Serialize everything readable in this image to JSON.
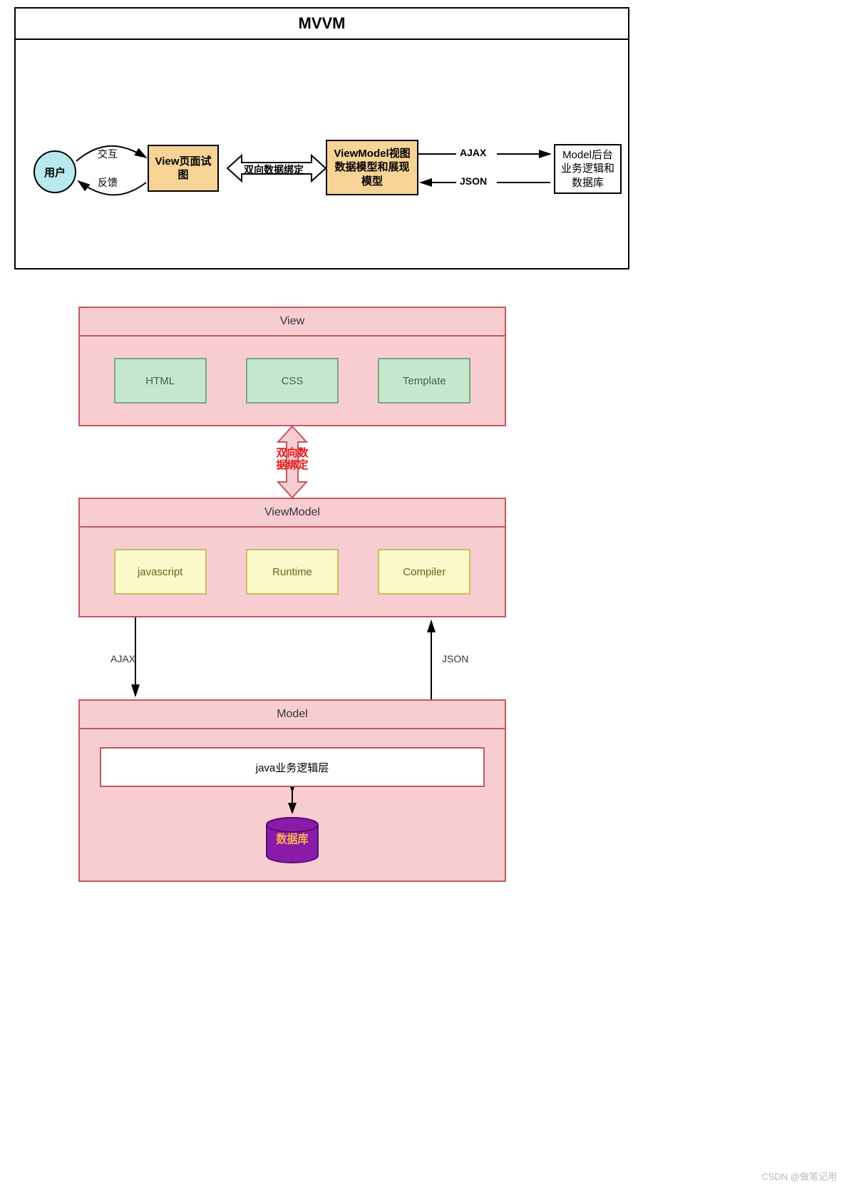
{
  "top": {
    "title": "MVVM",
    "user": "用户",
    "view": "View页面试图",
    "viewmodel": "ViewModel视图数据模型和展现模型",
    "model": "Model后台业务逻辑和数据库",
    "labels": {
      "interact": "交互",
      "feedback": "反馈",
      "bind": "双向数据绑定",
      "ajax": "AJAX",
      "json": "JSON"
    }
  },
  "bottom": {
    "view": {
      "title": "View",
      "items": [
        "HTML",
        "CSS",
        "Template"
      ]
    },
    "bind_label": "双向数据绑定",
    "viewmodel": {
      "title": "ViewModel",
      "items": [
        "javascript",
        "Runtime",
        "Compiler"
      ]
    },
    "conn": {
      "ajax": "AJAX",
      "json": "JSON"
    },
    "model": {
      "title": "Model",
      "logic": "java业务逻辑层",
      "db": "数据库"
    }
  },
  "watermark": "CSDN @做笔记用"
}
